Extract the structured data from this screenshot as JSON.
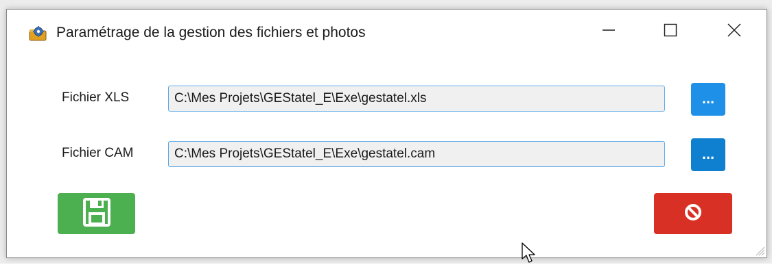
{
  "window": {
    "title": "Paramétrage de la gestion des fichiers et photos",
    "icon": "gear-folder-icon",
    "controls": {
      "minimize": "minimize-icon",
      "maximize": "maximize-icon",
      "close": "close-icon"
    }
  },
  "form": {
    "xls": {
      "label": "Fichier XLS",
      "value": "C:\\Mes Projets\\GEStatel_E\\Exe\\gestatel.xls",
      "browse_label": "..."
    },
    "cam": {
      "label": "Fichier CAM",
      "value": "C:\\Mes Projets\\GEStatel_E\\Exe\\gestatel.cam",
      "browse_label": "..."
    }
  },
  "actions": {
    "save_icon": "floppy-disk-icon",
    "cancel_icon": "prohibited-icon"
  },
  "colors": {
    "browse_xls": "#1e90e8",
    "browse_cam": "#0f7fd0",
    "save": "#4caf50",
    "cancel": "#d93025",
    "input_border": "#5aa8e8",
    "input_bg": "#f0f0f0"
  }
}
